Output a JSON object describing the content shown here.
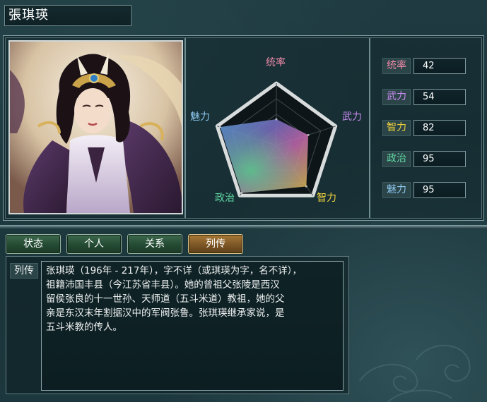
{
  "character": {
    "name": "張琪瑛"
  },
  "radar": {
    "labels": [
      {
        "text": "统率",
        "color": "#f08aa8"
      },
      {
        "text": "武力",
        "color": "#c98cf0"
      },
      {
        "text": "智力",
        "color": "#f0d23c"
      },
      {
        "text": "政治",
        "color": "#5fd6a0"
      },
      {
        "text": "魅力",
        "color": "#8ec8f0"
      }
    ]
  },
  "stats": [
    {
      "label": "统率",
      "value": "42",
      "color": "#f08aa8"
    },
    {
      "label": "武力",
      "value": "54",
      "color": "#c98cf0"
    },
    {
      "label": "智力",
      "value": "82",
      "color": "#f0d23c"
    },
    {
      "label": "政治",
      "value": "95",
      "color": "#5fd6a0"
    },
    {
      "label": "魅力",
      "value": "95",
      "color": "#8ec8f0"
    }
  ],
  "tabs": [
    {
      "label": "状态",
      "active": false
    },
    {
      "label": "个人",
      "active": false
    },
    {
      "label": "关系",
      "active": false
    },
    {
      "label": "列传",
      "active": true
    }
  ],
  "bio": {
    "label": "列传",
    "lines": [
      "张琪瑛（196年 - 217年），字不详（或琪瑛为字，名不详），",
      "祖籍沛国丰县（今江苏省丰县）。她的曾祖父张陵是西汉",
      "留侯张良的十一世孙、天师道（五斗米道）教祖，她的父",
      "亲是东汉末年割据汉中的军阀张鲁。张琪瑛继承家说，是",
      "五斗米教的传人。"
    ]
  }
}
